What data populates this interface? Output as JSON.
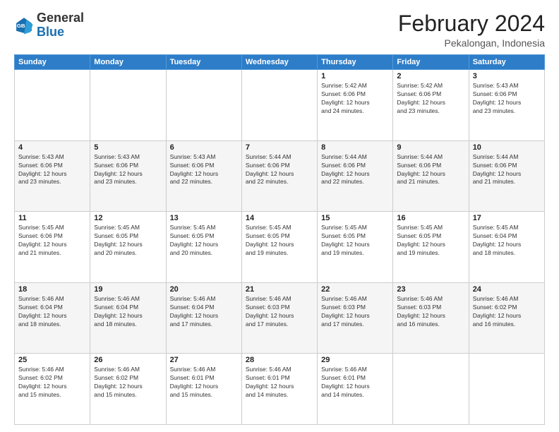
{
  "logo": {
    "general": "General",
    "blue": "Blue"
  },
  "header": {
    "title": "February 2024",
    "subtitle": "Pekalongan, Indonesia"
  },
  "weekdays": [
    "Sunday",
    "Monday",
    "Tuesday",
    "Wednesday",
    "Thursday",
    "Friday",
    "Saturday"
  ],
  "weeks": [
    [
      {
        "day": "",
        "info": ""
      },
      {
        "day": "",
        "info": ""
      },
      {
        "day": "",
        "info": ""
      },
      {
        "day": "",
        "info": ""
      },
      {
        "day": "1",
        "info": "Sunrise: 5:42 AM\nSunset: 6:06 PM\nDaylight: 12 hours\nand 24 minutes."
      },
      {
        "day": "2",
        "info": "Sunrise: 5:42 AM\nSunset: 6:06 PM\nDaylight: 12 hours\nand 23 minutes."
      },
      {
        "day": "3",
        "info": "Sunrise: 5:43 AM\nSunset: 6:06 PM\nDaylight: 12 hours\nand 23 minutes."
      }
    ],
    [
      {
        "day": "4",
        "info": "Sunrise: 5:43 AM\nSunset: 6:06 PM\nDaylight: 12 hours\nand 23 minutes."
      },
      {
        "day": "5",
        "info": "Sunrise: 5:43 AM\nSunset: 6:06 PM\nDaylight: 12 hours\nand 23 minutes."
      },
      {
        "day": "6",
        "info": "Sunrise: 5:43 AM\nSunset: 6:06 PM\nDaylight: 12 hours\nand 22 minutes."
      },
      {
        "day": "7",
        "info": "Sunrise: 5:44 AM\nSunset: 6:06 PM\nDaylight: 12 hours\nand 22 minutes."
      },
      {
        "day": "8",
        "info": "Sunrise: 5:44 AM\nSunset: 6:06 PM\nDaylight: 12 hours\nand 22 minutes."
      },
      {
        "day": "9",
        "info": "Sunrise: 5:44 AM\nSunset: 6:06 PM\nDaylight: 12 hours\nand 21 minutes."
      },
      {
        "day": "10",
        "info": "Sunrise: 5:44 AM\nSunset: 6:06 PM\nDaylight: 12 hours\nand 21 minutes."
      }
    ],
    [
      {
        "day": "11",
        "info": "Sunrise: 5:45 AM\nSunset: 6:06 PM\nDaylight: 12 hours\nand 21 minutes."
      },
      {
        "day": "12",
        "info": "Sunrise: 5:45 AM\nSunset: 6:05 PM\nDaylight: 12 hours\nand 20 minutes."
      },
      {
        "day": "13",
        "info": "Sunrise: 5:45 AM\nSunset: 6:05 PM\nDaylight: 12 hours\nand 20 minutes."
      },
      {
        "day": "14",
        "info": "Sunrise: 5:45 AM\nSunset: 6:05 PM\nDaylight: 12 hours\nand 19 minutes."
      },
      {
        "day": "15",
        "info": "Sunrise: 5:45 AM\nSunset: 6:05 PM\nDaylight: 12 hours\nand 19 minutes."
      },
      {
        "day": "16",
        "info": "Sunrise: 5:45 AM\nSunset: 6:05 PM\nDaylight: 12 hours\nand 19 minutes."
      },
      {
        "day": "17",
        "info": "Sunrise: 5:45 AM\nSunset: 6:04 PM\nDaylight: 12 hours\nand 18 minutes."
      }
    ],
    [
      {
        "day": "18",
        "info": "Sunrise: 5:46 AM\nSunset: 6:04 PM\nDaylight: 12 hours\nand 18 minutes."
      },
      {
        "day": "19",
        "info": "Sunrise: 5:46 AM\nSunset: 6:04 PM\nDaylight: 12 hours\nand 18 minutes."
      },
      {
        "day": "20",
        "info": "Sunrise: 5:46 AM\nSunset: 6:04 PM\nDaylight: 12 hours\nand 17 minutes."
      },
      {
        "day": "21",
        "info": "Sunrise: 5:46 AM\nSunset: 6:03 PM\nDaylight: 12 hours\nand 17 minutes."
      },
      {
        "day": "22",
        "info": "Sunrise: 5:46 AM\nSunset: 6:03 PM\nDaylight: 12 hours\nand 17 minutes."
      },
      {
        "day": "23",
        "info": "Sunrise: 5:46 AM\nSunset: 6:03 PM\nDaylight: 12 hours\nand 16 minutes."
      },
      {
        "day": "24",
        "info": "Sunrise: 5:46 AM\nSunset: 6:02 PM\nDaylight: 12 hours\nand 16 minutes."
      }
    ],
    [
      {
        "day": "25",
        "info": "Sunrise: 5:46 AM\nSunset: 6:02 PM\nDaylight: 12 hours\nand 15 minutes."
      },
      {
        "day": "26",
        "info": "Sunrise: 5:46 AM\nSunset: 6:02 PM\nDaylight: 12 hours\nand 15 minutes."
      },
      {
        "day": "27",
        "info": "Sunrise: 5:46 AM\nSunset: 6:01 PM\nDaylight: 12 hours\nand 15 minutes."
      },
      {
        "day": "28",
        "info": "Sunrise: 5:46 AM\nSunset: 6:01 PM\nDaylight: 12 hours\nand 14 minutes."
      },
      {
        "day": "29",
        "info": "Sunrise: 5:46 AM\nSunset: 6:01 PM\nDaylight: 12 hours\nand 14 minutes."
      },
      {
        "day": "",
        "info": ""
      },
      {
        "day": "",
        "info": ""
      }
    ]
  ]
}
